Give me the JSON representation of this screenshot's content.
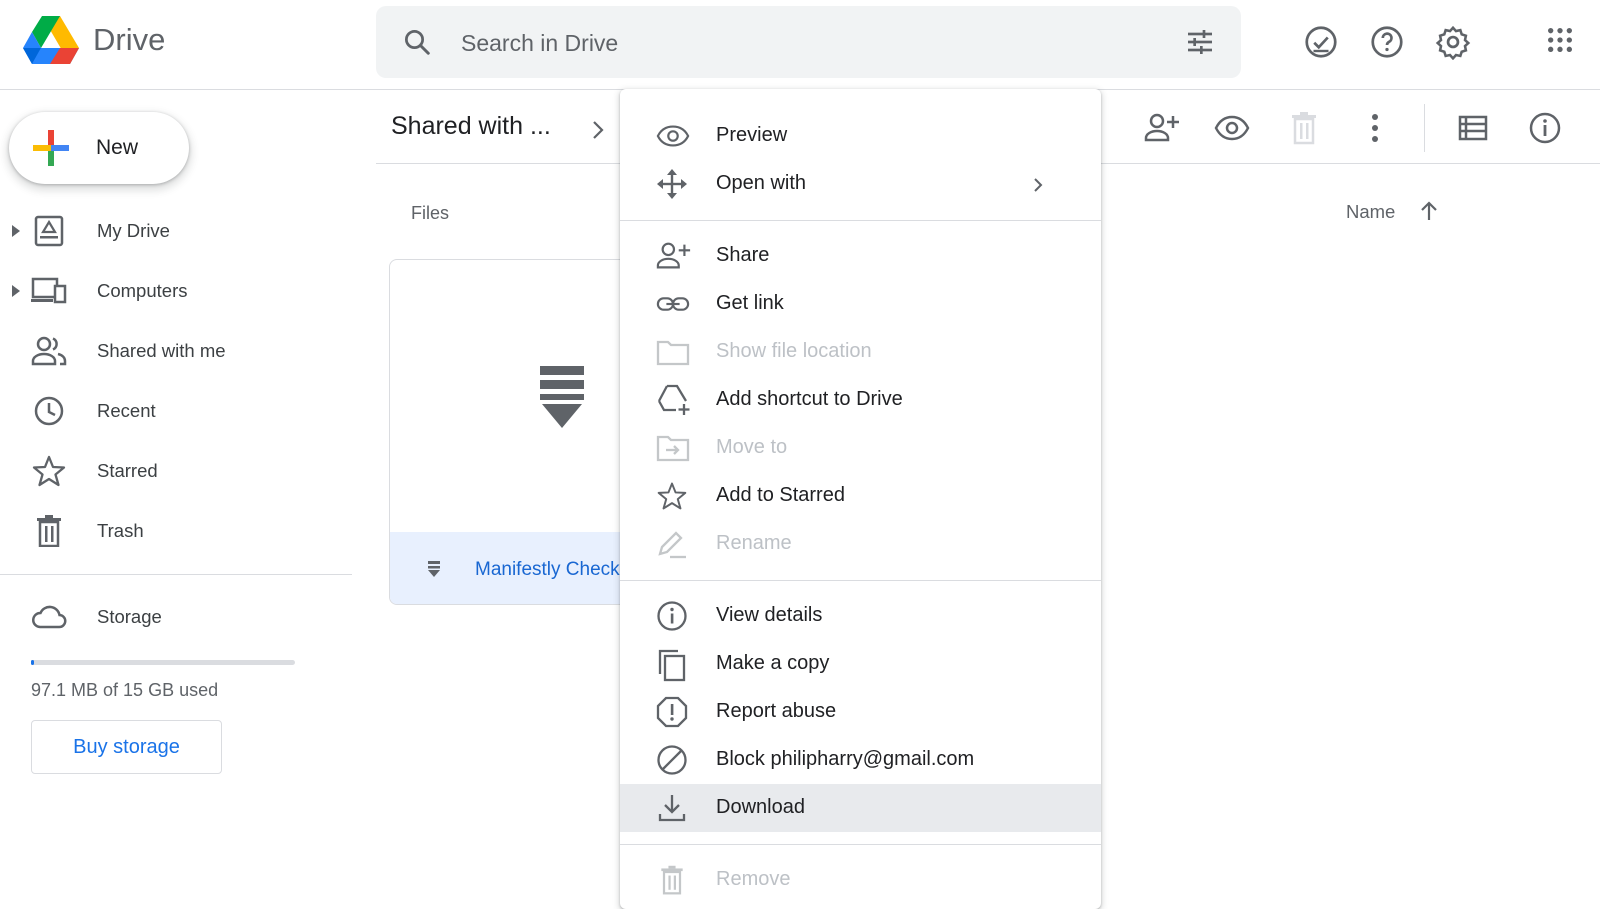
{
  "header": {
    "brand": "Drive",
    "search_placeholder": "Search in Drive",
    "icons": [
      "search-icon",
      "tune-icon",
      "ready-for-offline-icon",
      "help-icon",
      "settings-icon",
      "apps-grid-icon"
    ]
  },
  "sidebar": {
    "new_label": "New",
    "items": [
      {
        "label": "My Drive",
        "icon": "my-drive-icon"
      },
      {
        "label": "Computers",
        "icon": "computers-icon"
      },
      {
        "label": "Shared with me",
        "icon": "shared-with-me-icon"
      },
      {
        "label": "Recent",
        "icon": "clock-icon"
      },
      {
        "label": "Starred",
        "icon": "star-icon"
      },
      {
        "label": "Trash",
        "icon": "trash-icon"
      }
    ],
    "storage": {
      "label": "Storage",
      "used_text": "97.1 MB of 15 GB used",
      "used_fraction": 0.006,
      "buy_label": "Buy storage"
    }
  },
  "main": {
    "breadcrumb": "Shared with ...",
    "section_label": "Files",
    "sort": {
      "label": "Name",
      "direction": "ascending"
    },
    "toolbar_icons": [
      "add-person-icon",
      "preview-eye-icon",
      "trash-icon",
      "more-vert-icon",
      "list-view-icon",
      "info-icon"
    ],
    "file": {
      "name": "Manifestly Check",
      "icon": "file-download-icon"
    }
  },
  "context_menu": {
    "groups": [
      [
        {
          "label": "Preview",
          "icon": "eye-icon",
          "disabled": false
        },
        {
          "label": "Open with",
          "icon": "open-with-icon",
          "disabled": false,
          "submenu": true
        }
      ],
      [
        {
          "label": "Share",
          "icon": "person-add-icon",
          "disabled": false
        },
        {
          "label": "Get link",
          "icon": "link-icon",
          "disabled": false
        },
        {
          "label": "Show file location",
          "icon": "folder-icon",
          "disabled": true
        },
        {
          "label": "Add shortcut to Drive",
          "icon": "add-shortcut-icon",
          "disabled": false
        },
        {
          "label": "Move to",
          "icon": "move-to-folder-icon",
          "disabled": true
        },
        {
          "label": "Add to Starred",
          "icon": "star-icon",
          "disabled": false
        },
        {
          "label": "Rename",
          "icon": "pencil-icon",
          "disabled": true
        }
      ],
      [
        {
          "label": "View details",
          "icon": "info-icon",
          "disabled": false
        },
        {
          "label": "Make a copy",
          "icon": "copy-icon",
          "disabled": false
        },
        {
          "label": "Report abuse",
          "icon": "report-icon",
          "disabled": false
        },
        {
          "label": "Block philipharry@gmail.com",
          "icon": "block-icon",
          "disabled": false
        },
        {
          "label": "Download",
          "icon": "download-icon",
          "disabled": false,
          "highlighted": true
        }
      ],
      [
        {
          "label": "Remove",
          "icon": "trash-icon",
          "disabled": true
        }
      ]
    ]
  },
  "colors": {
    "accent": "#1a73e8",
    "file_selected_bg": "#e8f0fe",
    "menu_highlight": "#e8eaed",
    "disabled_text": "#bdc1c6",
    "icon_gray": "#5f6368"
  }
}
